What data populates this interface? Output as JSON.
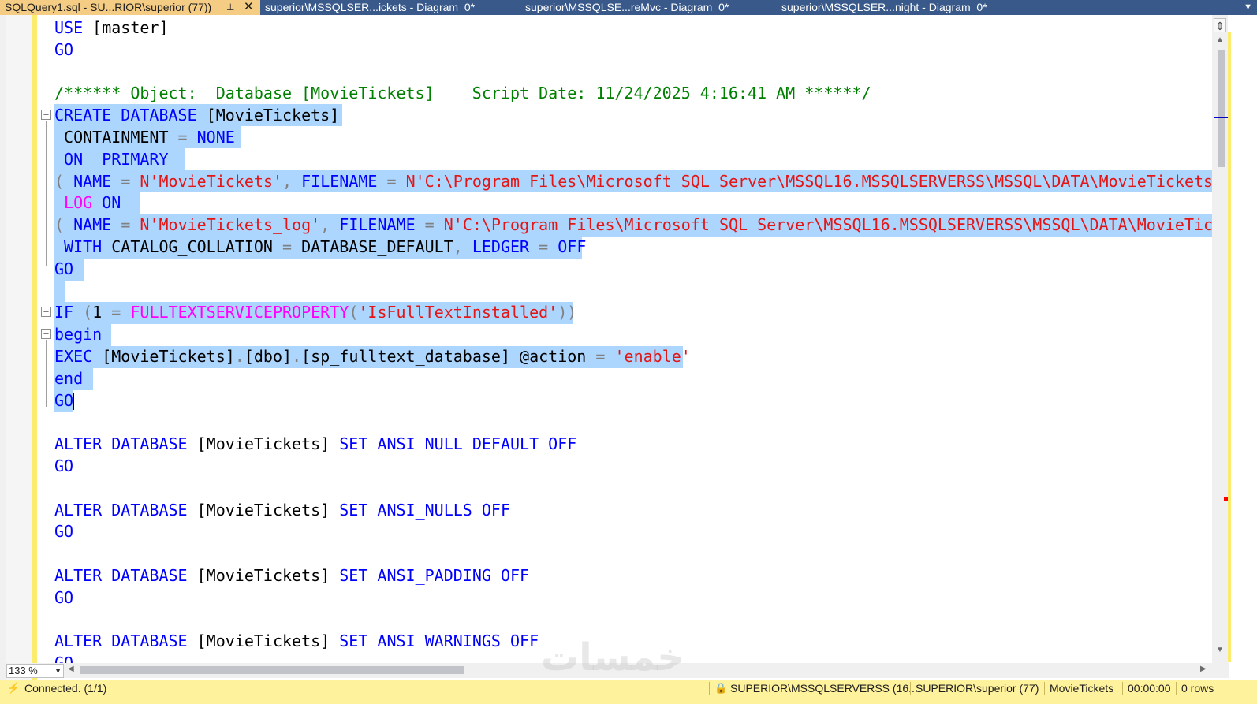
{
  "tabs": [
    {
      "label": "SQLQuery1.sql - SU...RIOR\\superior (77))",
      "active": true
    },
    {
      "label": "superior\\MSSQLSER...ickets - Diagram_0*",
      "active": false
    },
    {
      "label": "superior\\MSSQLSE...reMvc - Diagram_0*",
      "active": false
    },
    {
      "label": "superior\\MSSQLSER...night - Diagram_0*",
      "active": false
    }
  ],
  "tab_icons": {
    "pin": "pin-icon",
    "close": "close-icon",
    "menu": "dropdown-icon"
  },
  "code_lines": [
    [
      [
        "kw",
        "USE "
      ],
      [
        "df",
        "[master]"
      ]
    ],
    [
      [
        "kw",
        "GO"
      ]
    ],
    [],
    [
      [
        "cm",
        "/****** Object:  Database [MovieTickets]    Script Date: 11/24/2025 4:16:41 AM ******/"
      ]
    ],
    [
      [
        "kw",
        "CREATE DATABASE "
      ],
      [
        "df",
        "[MovieTickets]"
      ]
    ],
    [
      [
        "df",
        " CONTAINMENT "
      ],
      [
        "gr",
        "= "
      ],
      [
        "kw",
        "NONE"
      ]
    ],
    [
      [
        "kw",
        " ON  PRIMARY"
      ]
    ],
    [
      [
        "gr",
        "( "
      ],
      [
        "kw",
        "NAME "
      ],
      [
        "gr",
        "= "
      ],
      [
        "st",
        "N'MovieTickets'"
      ],
      [
        "gr",
        ", "
      ],
      [
        "kw",
        "FILENAME "
      ],
      [
        "gr",
        "= "
      ],
      [
        "st",
        "N'C:\\Program Files\\Microsoft SQL Server\\MSSQL16.MSSQLSERVERSS\\MSSQL\\DATA\\MovieTickets.mdf"
      ]
    ],
    [
      [
        "fn",
        " LOG "
      ],
      [
        "kw",
        "ON"
      ]
    ],
    [
      [
        "gr",
        "( "
      ],
      [
        "kw",
        "NAME "
      ],
      [
        "gr",
        "= "
      ],
      [
        "st",
        "N'MovieTickets_log'"
      ],
      [
        "gr",
        ", "
      ],
      [
        "kw",
        "FILENAME "
      ],
      [
        "gr",
        "= "
      ],
      [
        "st",
        "N'C:\\Program Files\\Microsoft SQL Server\\MSSQL16.MSSQLSERVERSS\\MSSQL\\DATA\\MovieTickets"
      ]
    ],
    [
      [
        "kw",
        " WITH "
      ],
      [
        "df",
        "CATALOG_COLLATION "
      ],
      [
        "gr",
        "= "
      ],
      [
        "df",
        "DATABASE_DEFAULT"
      ],
      [
        "gr",
        ", "
      ],
      [
        "kw",
        "LEDGER "
      ],
      [
        "gr",
        "= "
      ],
      [
        "kw",
        "OFF"
      ]
    ],
    [
      [
        "kw",
        "GO"
      ]
    ],
    [],
    [
      [
        "kw",
        "IF "
      ],
      [
        "gr",
        "("
      ],
      [
        "df",
        "1 "
      ],
      [
        "gr",
        "= "
      ],
      [
        "fn",
        "FULLTEXTSERVICEPROPERTY"
      ],
      [
        "gr",
        "("
      ],
      [
        "st",
        "'IsFullTextInstalled'"
      ],
      [
        "gr",
        "))"
      ]
    ],
    [
      [
        "kw",
        "begin"
      ]
    ],
    [
      [
        "kw",
        "EXEC "
      ],
      [
        "df",
        "[MovieTickets]"
      ],
      [
        "gr",
        "."
      ],
      [
        "df",
        "[dbo]"
      ],
      [
        "gr",
        "."
      ],
      [
        "df",
        "[sp_fulltext_database] @action "
      ],
      [
        "gr",
        "= "
      ],
      [
        "st",
        "'enable'"
      ]
    ],
    [
      [
        "kw",
        "end"
      ]
    ],
    [
      [
        "kw",
        "GO"
      ]
    ],
    [],
    [
      [
        "kw",
        "ALTER DATABASE "
      ],
      [
        "df",
        "[MovieTickets] "
      ],
      [
        "kw",
        "SET ANSI_NULL_DEFAULT OFF"
      ]
    ],
    [
      [
        "kw",
        "GO"
      ]
    ],
    [],
    [
      [
        "kw",
        "ALTER DATABASE "
      ],
      [
        "df",
        "[MovieTickets] "
      ],
      [
        "kw",
        "SET ANSI_NULLS OFF"
      ]
    ],
    [
      [
        "kw",
        "GO"
      ]
    ],
    [],
    [
      [
        "kw",
        "ALTER DATABASE "
      ],
      [
        "df",
        "[MovieTickets] "
      ],
      [
        "kw",
        "SET ANSI_PADDING OFF"
      ]
    ],
    [
      [
        "kw",
        "GO"
      ]
    ],
    [],
    [
      [
        "kw",
        "ALTER DATABASE "
      ],
      [
        "df",
        "[MovieTickets] "
      ],
      [
        "kw",
        "SET ANSI_WARNINGS OFF"
      ]
    ],
    [
      [
        "kw",
        "GO"
      ]
    ]
  ],
  "syntax_colors": {
    "kw": "#0000ff",
    "st": "#e31515",
    "gr": "#808080",
    "cm": "#008000",
    "fn": "#ff00ff",
    "df": "#000000"
  },
  "selection_color": "#add6ff",
  "fold_glyph": "−",
  "editor": {
    "zoom": "133 %",
    "split_icon": "split-view-icon",
    "scroll_up": "▲",
    "scroll_down": "▼",
    "scroll_left": "◀",
    "scroll_right": "▶",
    "zoom_arrow": "▼"
  },
  "watermark": "خمسات",
  "status": {
    "connection": "Connected. (1/1)",
    "server": "SUPERIOR\\MSSQLSERVERSS (16....",
    "user": "SUPERIOR\\superior (77)",
    "database": "MovieTickets",
    "elapsed": "00:00:00",
    "rows": "0 rows",
    "bg_color": "#fff29d"
  }
}
